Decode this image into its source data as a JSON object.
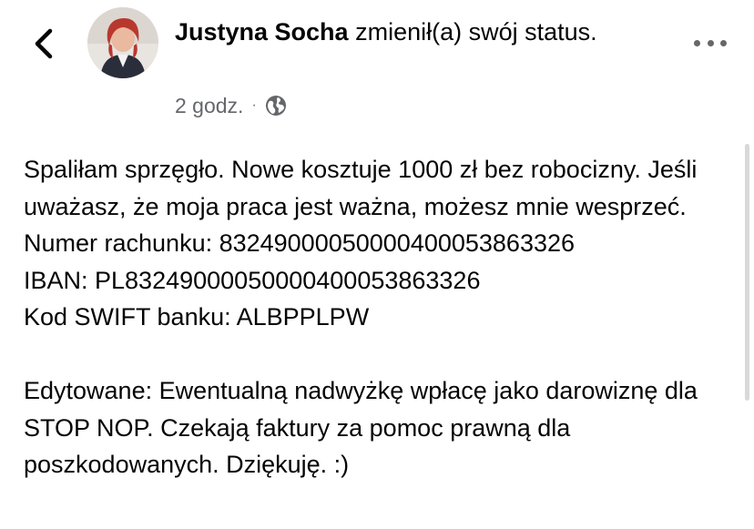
{
  "header": {
    "author_name": "Justyna Socha",
    "status_text": " zmienił(a) swój status.",
    "timestamp": "2 godz.",
    "separator": "·",
    "audience_icon": "globe-icon",
    "back_icon": "chevron-left-icon",
    "menu_icon": "more-horizontal-icon"
  },
  "post": {
    "lines": [
      "Spaliłam sprzęgło. Nowe kosztuje 1000 zł bez robocizny. Jeśli uważasz, że moja praca jest ważna, możesz mnie wesprzeć.",
      "Numer rachunku: 83249000050000400053863326",
      "IBAN: PL83249000050000400053863326",
      "Kod SWIFT banku: ALBPPLPW"
    ],
    "edit_note": "Edytowane: Ewentualną nadwyżkę wpłacę jako darowiznę dla STOP NOP. Czekają faktury za pomoc prawną dla poszkodowanych. Dziękuję. :)"
  },
  "colors": {
    "text_primary": "#050505",
    "text_secondary": "#65676b",
    "background": "#ffffff"
  }
}
